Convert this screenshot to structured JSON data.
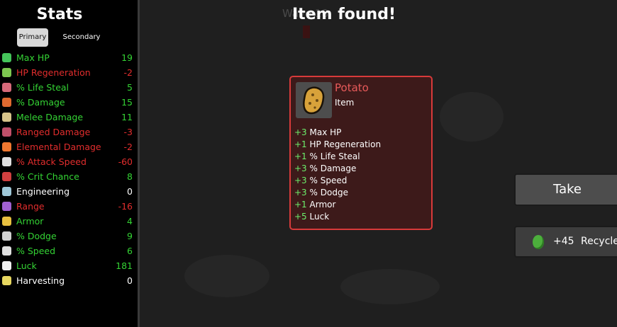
{
  "stats_panel": {
    "title": "Stats",
    "tabs": [
      {
        "label": "Primary"
      },
      {
        "label": "Secondary"
      }
    ],
    "stats": [
      {
        "name": "Max HP",
        "value": "19",
        "color": "#34d334",
        "icon": "heart-icon",
        "icon_color": "#45c45a"
      },
      {
        "name": "HP Regeneration",
        "value": "-2",
        "color": "#e22d2d",
        "icon": "regen-icon",
        "icon_color": "#7ec850"
      },
      {
        "name": "% Life Steal",
        "value": "5",
        "color": "#34d334",
        "icon": "vampire-icon",
        "icon_color": "#d76a7a"
      },
      {
        "name": "% Damage",
        "value": "15",
        "color": "#34d334",
        "icon": "damage-icon",
        "icon_color": "#e06a30"
      },
      {
        "name": "Melee Damage",
        "value": "11",
        "color": "#34d334",
        "icon": "sword-icon",
        "icon_color": "#d8c48a"
      },
      {
        "name": "Ranged Damage",
        "value": "-3",
        "color": "#e22d2d",
        "icon": "bow-icon",
        "icon_color": "#c0506a"
      },
      {
        "name": "Elemental Damage",
        "value": "-2",
        "color": "#e22d2d",
        "icon": "fire-icon",
        "icon_color": "#f07830"
      },
      {
        "name": "% Attack Speed",
        "value": "-60",
        "color": "#e22d2d",
        "icon": "hourglass-icon",
        "icon_color": "#e0e0e0"
      },
      {
        "name": "% Crit Chance",
        "value": "8",
        "color": "#34d334",
        "icon": "crit-icon",
        "icon_color": "#d04040"
      },
      {
        "name": "Engineering",
        "value": "0",
        "color": "#ffffff",
        "icon": "wrench-icon",
        "icon_color": "#a0c8d8"
      },
      {
        "name": "Range",
        "value": "-16",
        "color": "#e22d2d",
        "icon": "range-icon",
        "icon_color": "#a060d0"
      },
      {
        "name": "Armor",
        "value": "4",
        "color": "#34d334",
        "icon": "shield-icon",
        "icon_color": "#e8c040"
      },
      {
        "name": "% Dodge",
        "value": "9",
        "color": "#34d334",
        "icon": "dodge-icon",
        "icon_color": "#d0d0d0"
      },
      {
        "name": "% Speed",
        "value": "6",
        "color": "#34d334",
        "icon": "boot-icon",
        "icon_color": "#e0e0e0"
      },
      {
        "name": "Luck",
        "value": "181",
        "color": "#34d334",
        "icon": "clover-icon",
        "icon_color": "#f0f0f0"
      },
      {
        "name": "Harvesting",
        "value": "0",
        "color": "#ffffff",
        "icon": "harvest-icon",
        "icon_color": "#e8d860"
      }
    ]
  },
  "background": {
    "wave_text": "Wave 18"
  },
  "popup": {
    "title": "Item found!",
    "item": {
      "name": "Potato",
      "type": "Item",
      "image_icon": "potato-icon",
      "effects": [
        {
          "amount": "+3",
          "stat": "Max HP"
        },
        {
          "amount": "+1",
          "stat": "HP Regeneration"
        },
        {
          "amount": "+1",
          "stat": "% Life Steal"
        },
        {
          "amount": "+3",
          "stat": "% Damage"
        },
        {
          "amount": "+3",
          "stat": "% Speed"
        },
        {
          "amount": "+3",
          "stat": "% Dodge"
        },
        {
          "amount": "+1",
          "stat": "Armor"
        },
        {
          "amount": "+5",
          "stat": "Luck"
        }
      ]
    },
    "take_label": "Take",
    "recycle": {
      "amount": "+45",
      "label": "Recycle",
      "icon": "material-icon"
    }
  }
}
